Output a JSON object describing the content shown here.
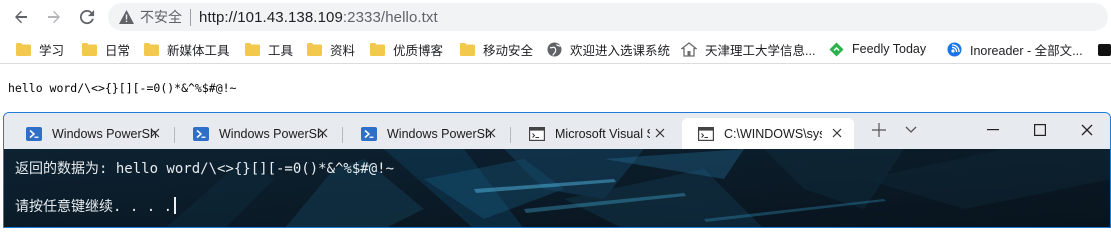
{
  "browser": {
    "security_label": "不安全",
    "url_host": "http://101.43.138.109",
    "url_rest": ":2333/hello.txt",
    "bookmarks": [
      {
        "label": "学习",
        "icon": "folder-icon"
      },
      {
        "label": "日常",
        "icon": "folder-icon"
      },
      {
        "label": "新媒体工具",
        "icon": "folder-icon"
      },
      {
        "label": "工具",
        "icon": "folder-icon"
      },
      {
        "label": "资料",
        "icon": "folder-icon"
      },
      {
        "label": "优质博客",
        "icon": "folder-icon"
      },
      {
        "label": "移动安全",
        "icon": "folder-icon"
      },
      {
        "label": "欢迎进入选课系统",
        "icon": "globe-icon"
      },
      {
        "label": "天津理工大学信息...",
        "icon": "school-icon"
      },
      {
        "label": "Feedly Today",
        "icon": "feedly-icon"
      },
      {
        "label": "Inoreader - 全部文...",
        "icon": "inoreader-icon"
      }
    ]
  },
  "page": {
    "content": "hello word/\\<>{}[][-=0()*&^%$#@!~"
  },
  "terminal": {
    "tabs": [
      {
        "label": "Windows PowerSh",
        "icon": "powershell-icon",
        "active": false
      },
      {
        "label": "Windows PowerSh",
        "icon": "powershell-icon",
        "active": false
      },
      {
        "label": "Windows PowerSh",
        "icon": "powershell-icon",
        "active": false
      },
      {
        "label": "Microsoft Visual S",
        "icon": "cmd-icon",
        "active": false
      },
      {
        "label": "C:\\WINDOWS\\syst",
        "icon": "cmd-icon",
        "active": true
      }
    ],
    "line1": "返回的数据为: hello word/\\<>{}[][-=0()*&^%$#@!~",
    "line2": "请按任意键继续. . . ."
  },
  "colors": {
    "accent": "#1e7bd6",
    "folder": "#f2c94c",
    "terminal_bg": "#0b1a26",
    "terminal_text": "#e8ecef"
  }
}
